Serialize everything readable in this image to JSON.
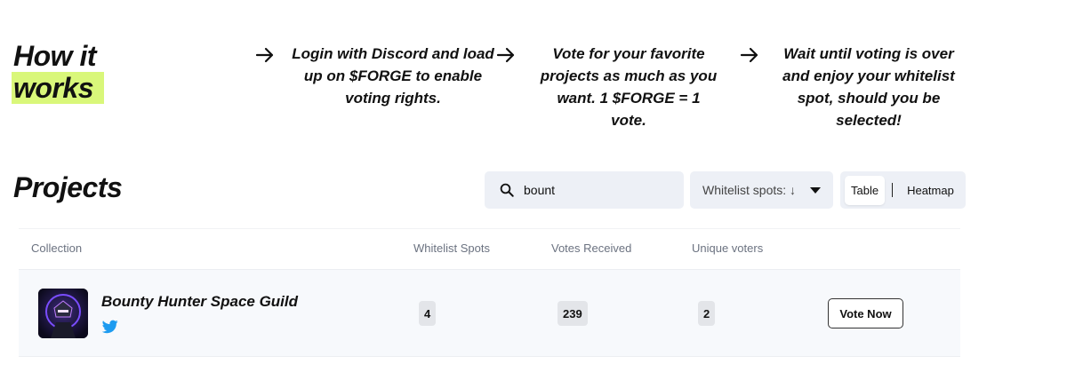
{
  "how_it_works": {
    "title_line1": "How it",
    "title_line2": "works",
    "steps": [
      "Login with Discord and load up on $FORGE to enable voting rights.",
      "Vote for your favorite projects as much as you want. 1 $FORGE = 1 vote.",
      "Wait until voting is over and enjoy your whitelist spot, should you be selected!"
    ]
  },
  "projects": {
    "title": "Projects",
    "search": {
      "value": "bount",
      "placeholder": ""
    },
    "sort": {
      "label": "Whitelist spots: ↓"
    },
    "view_toggle": {
      "options": [
        "Table",
        "Heatmap"
      ],
      "active": "Table"
    },
    "columns": [
      "Collection",
      "Whitelist Spots",
      "Votes Received",
      "Unique voters"
    ],
    "rows": [
      {
        "name": "Bounty Hunter Space Guild",
        "whitelist_spots": "4",
        "votes_received": "239",
        "unique_voters": "2",
        "action_label": "Vote Now"
      }
    ]
  },
  "colors": {
    "highlight": "#d9f77a",
    "control_bg": "#edf0f6",
    "row_bg": "#f7f9fc",
    "twitter": "#1d9bf0"
  },
  "icons": [
    "arrow-right-icon",
    "search-icon",
    "caret-down-icon",
    "twitter-icon"
  ]
}
